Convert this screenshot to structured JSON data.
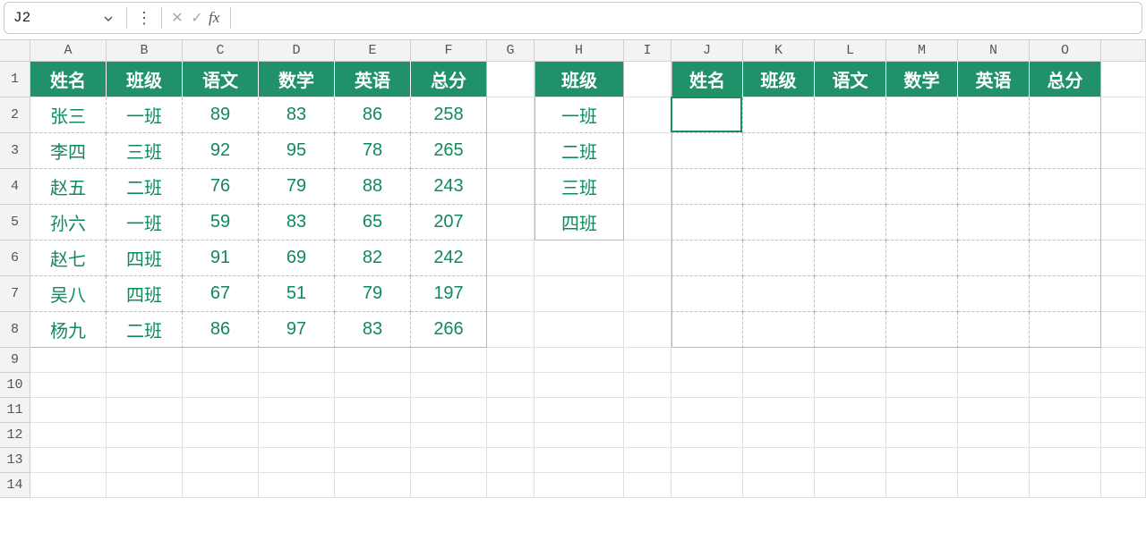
{
  "nameBox": "J2",
  "formula": "",
  "columns": [
    "A",
    "B",
    "C",
    "D",
    "E",
    "F",
    "G",
    "H",
    "I",
    "J",
    "K",
    "L",
    "M",
    "N",
    "O"
  ],
  "rowCount": 14,
  "activeCell": {
    "row": 2,
    "col": "J"
  },
  "table1": {
    "headers": [
      "姓名",
      "班级",
      "语文",
      "数学",
      "英语",
      "总分"
    ],
    "rows": [
      [
        "张三",
        "一班",
        "89",
        "83",
        "86",
        "258"
      ],
      [
        "李四",
        "三班",
        "92",
        "95",
        "78",
        "265"
      ],
      [
        "赵五",
        "二班",
        "76",
        "79",
        "88",
        "243"
      ],
      [
        "孙六",
        "一班",
        "59",
        "83",
        "65",
        "207"
      ],
      [
        "赵七",
        "四班",
        "91",
        "69",
        "82",
        "242"
      ],
      [
        "吴八",
        "四班",
        "67",
        "51",
        "79",
        "197"
      ],
      [
        "杨九",
        "二班",
        "86",
        "97",
        "83",
        "266"
      ]
    ]
  },
  "table2": {
    "header": "班级",
    "rows": [
      "一班",
      "二班",
      "三班",
      "四班"
    ]
  },
  "table3": {
    "headers": [
      "姓名",
      "班级",
      "语文",
      "数学",
      "英语",
      "总分"
    ],
    "rowCount": 7
  },
  "icons": {
    "chevron": "⌄",
    "dots": "⋮",
    "cancel": "✕",
    "accept": "✓",
    "fx": "fx"
  }
}
